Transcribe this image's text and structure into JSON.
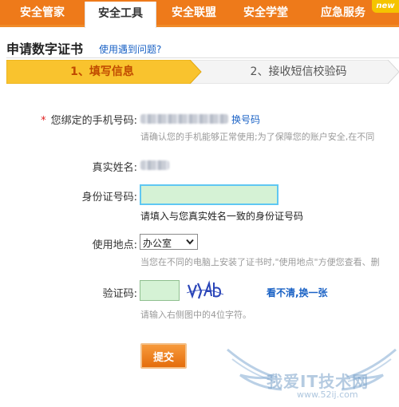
{
  "nav": {
    "tabs": [
      {
        "label": "安全管家",
        "active": false
      },
      {
        "label": "安全工具",
        "active": true
      },
      {
        "label": "安全联盟",
        "active": false
      },
      {
        "label": "安全学堂",
        "active": false
      },
      {
        "label": "应急服务",
        "active": false
      }
    ],
    "new_badge": "new"
  },
  "page": {
    "title": "申请数字证书",
    "help_link": "使用遇到问题?"
  },
  "steps": [
    {
      "label": "1、填写信息",
      "active": true
    },
    {
      "label": "2、接收短信校验码",
      "active": false
    }
  ],
  "form": {
    "phone": {
      "label": "您绑定的手机号码:",
      "change_link": "换号码",
      "hint": "请确认您的手机能够正常使用;为了保障您的账户安全,在不同"
    },
    "name": {
      "label": "真实姓名:"
    },
    "id_number": {
      "label": "身份证号码:",
      "value": "",
      "hint": "请填入与您真实姓名一致的身份证号码"
    },
    "location": {
      "label": "使用地点:",
      "selected": "办公室",
      "hint": "当您在不同的电脑上安装了证书时,\"使用地点\"方便您查看、删"
    },
    "captcha": {
      "label": "验证码:",
      "value": "",
      "refresh_link": "看不清,换一张",
      "hint": "请输入右侧图中的4位字符。"
    },
    "submit_label": "提交"
  },
  "watermark": {
    "text": "我爱IT技术网",
    "url": "www.52ij.com"
  },
  "colors": {
    "nav_bg": "#ee7a1a",
    "step_active": "#f9c32e",
    "link": "#1a62c5",
    "input_bg": "#d5f2d5",
    "input_focus": "#5fc7f2"
  }
}
